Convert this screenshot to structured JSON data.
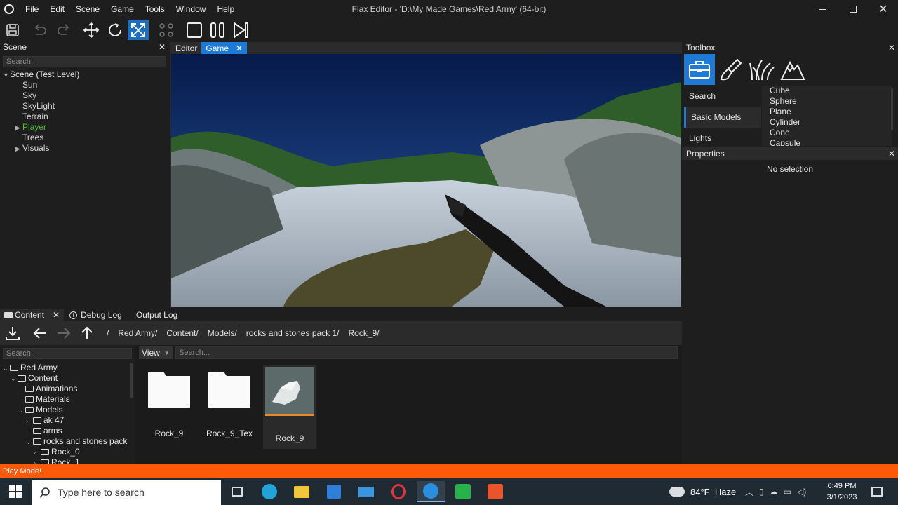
{
  "window": {
    "title": "Flax Editor - 'D:\\My Made Games\\Red Army' (64-bit)",
    "menu": [
      "File",
      "Edit",
      "Scene",
      "Game",
      "Tools",
      "Window",
      "Help"
    ]
  },
  "toolbar": {
    "icons": [
      "save-icon",
      "undo-icon",
      "redo-icon",
      "translate-icon",
      "rotate-icon",
      "scale-icon",
      "snap-icon",
      "stop-icon",
      "pause-icon",
      "step-icon"
    ],
    "active": "scale-icon"
  },
  "scene_panel": {
    "title": "Scene",
    "search_placeholder": "Search...",
    "root": "Scene (Test Level)",
    "items": [
      {
        "label": "Sun",
        "expandable": false,
        "color": "#d8d8d8"
      },
      {
        "label": "Sky",
        "expandable": false,
        "color": "#d8d8d8"
      },
      {
        "label": "SkyLight",
        "expandable": false,
        "color": "#d8d8d8"
      },
      {
        "label": "Terrain",
        "expandable": false,
        "color": "#d8d8d8"
      },
      {
        "label": "Player",
        "expandable": true,
        "color": "#4fbf3a"
      },
      {
        "label": "Trees",
        "expandable": false,
        "color": "#d8d8d8"
      },
      {
        "label": "Visuals",
        "expandable": true,
        "color": "#d8d8d8"
      }
    ]
  },
  "viewport": {
    "tabs": [
      {
        "label": "Editor",
        "selected": false
      },
      {
        "label": "Game",
        "selected": true
      }
    ]
  },
  "toolbox": {
    "title": "Toolbox",
    "icons": [
      "toolbox-icon",
      "paint-brush-icon",
      "foliage-icon",
      "terrain-icon"
    ],
    "categories": [
      {
        "label": "Search",
        "selected": false
      },
      {
        "label": "Basic Models",
        "selected": true
      },
      {
        "label": "Lights",
        "selected": false
      }
    ],
    "models": [
      "Cube",
      "Sphere",
      "Plane",
      "Cylinder",
      "Cone",
      "Capsule"
    ]
  },
  "properties": {
    "title": "Properties",
    "empty_text": "No selection"
  },
  "bottom_tabs": [
    {
      "label": "Content",
      "icon": "folder-icon",
      "closable": true
    },
    {
      "label": "Debug Log",
      "icon": "info-icon",
      "closable": false
    },
    {
      "label": "Output Log",
      "icon": "",
      "closable": false
    }
  ],
  "content": {
    "breadcrumb": [
      "/",
      "Red Army/",
      "Content/",
      "Models/",
      "rocks and stones pack 1/",
      "Rock_9/"
    ],
    "tree_search_placeholder": "Search...",
    "view_label": "View",
    "search_placeholder": "Search...",
    "tree": [
      {
        "label": "Red Army",
        "depth": 0,
        "arrow": "v"
      },
      {
        "label": "Content",
        "depth": 1,
        "arrow": "v"
      },
      {
        "label": "Animations",
        "depth": 2,
        "arrow": ""
      },
      {
        "label": "Materials",
        "depth": 2,
        "arrow": ""
      },
      {
        "label": "Models",
        "depth": 2,
        "arrow": "v"
      },
      {
        "label": "ak 47",
        "depth": 3,
        "arrow": ">"
      },
      {
        "label": "arms",
        "depth": 3,
        "arrow": ""
      },
      {
        "label": "rocks and stones pack",
        "depth": 3,
        "arrow": "v"
      },
      {
        "label": "Rock_0",
        "depth": 4,
        "arrow": ">"
      },
      {
        "label": "Rock_1",
        "depth": 4,
        "arrow": ">"
      }
    ],
    "assets": [
      {
        "label": "Rock_9",
        "kind": "folder"
      },
      {
        "label": "Rock_9_Tex",
        "kind": "folder"
      },
      {
        "label": "Rock_9",
        "kind": "model"
      }
    ]
  },
  "status": {
    "text": "Play Mode!",
    "color": "#ff5a0a"
  },
  "taskbar": {
    "search_placeholder": "Type here to search",
    "weather": "84°F  Haze",
    "time": "6:49 PM",
    "date": "3/1/2023"
  }
}
